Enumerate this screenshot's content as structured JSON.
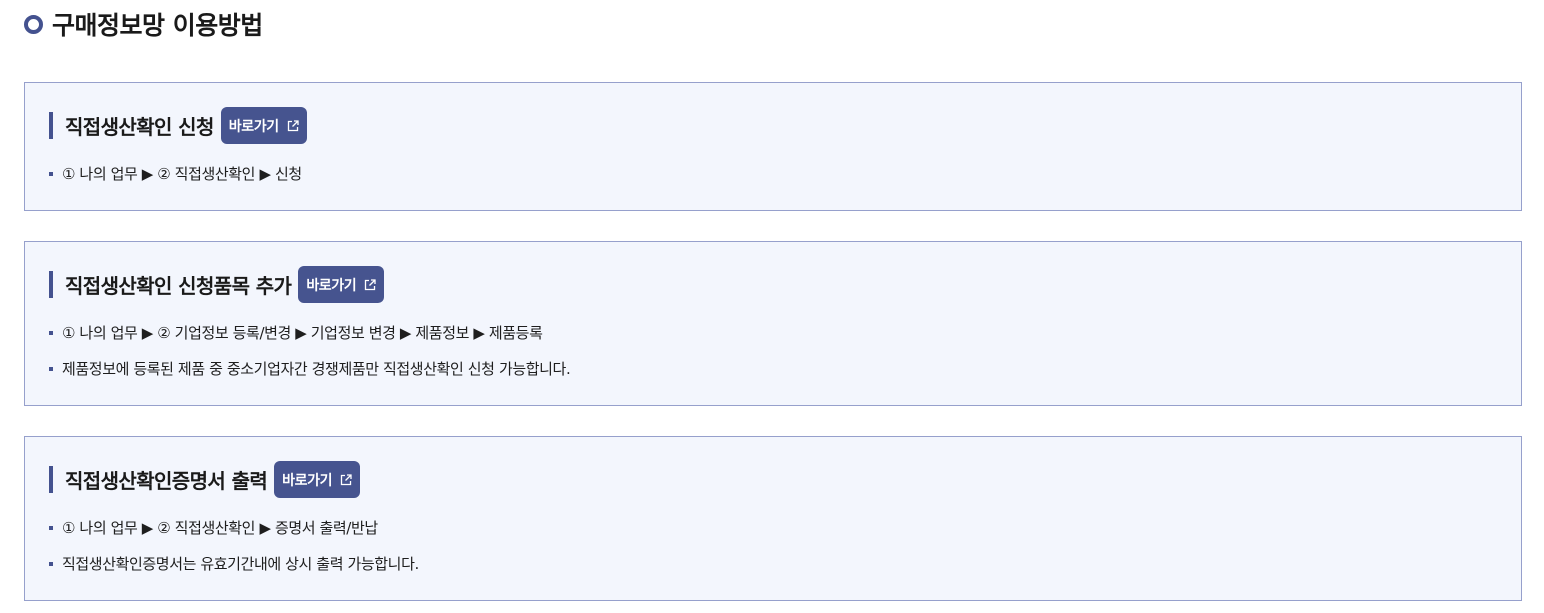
{
  "page": {
    "title": "구매정보망 이용방법"
  },
  "sections": [
    {
      "title": "직접생산확인 신청",
      "button_label": "바로가기",
      "items": [
        "① 나의 업무 ▶ ② 직접생산확인 ▶ 신청"
      ]
    },
    {
      "title": "직접생산확인 신청품목 추가",
      "button_label": "바로가기",
      "items": [
        "① 나의 업무 ▶ ② 기업정보 등록/변경 ▶ 기업정보 변경 ▶ 제품정보 ▶ 제품등록",
        "제품정보에 등록된 제품 중 중소기업자간 경쟁제품만 직접생산확인 신청 가능합니다."
      ]
    },
    {
      "title": "직접생산확인증명서 출력",
      "button_label": "바로가기",
      "items": [
        "① 나의 업무 ▶ ② 직접생산확인 ▶ 증명서 출력/반납",
        "직접생산확인증명서는 유효기간내에 상시 출력 가능합니다."
      ]
    }
  ],
  "icons": {
    "title_marker": "circle-ring-icon",
    "button_icon": "external-link-icon"
  },
  "colors": {
    "accent": "#44528f",
    "section_background": "#f3f6fd",
    "section_border": "#96a0cc",
    "button_text": "#ffffff"
  }
}
